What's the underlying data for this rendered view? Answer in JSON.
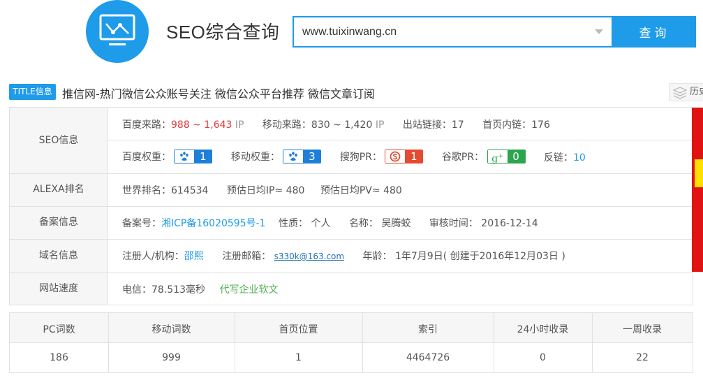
{
  "header": {
    "logo_icon": "line-chart-monitor-icon",
    "title": "SEO综合查询",
    "search_value": "www.tuixinwang.cn",
    "search_button": "查询",
    "accent_color": "#1e9be9"
  },
  "title_row": {
    "badge": "TITLE信息",
    "text": "推信网-热门微信公众账号关注 微信公众平台推荐 微信文章订阅",
    "history_label": "历史"
  },
  "seo": {
    "label": "SEO信息",
    "baidu_traffic_label": "百度来路：",
    "baidu_traffic_value": "988 ~ 1,643",
    "baidu_traffic_unit": "IP",
    "mobile_traffic_label": "移动来路：",
    "mobile_traffic_value": "830 ~ 1,420",
    "mobile_traffic_unit": "IP",
    "outbound_links_label": "出站链接：",
    "outbound_links_value": "17",
    "home_internal_links_label": "首页内链：",
    "home_internal_links_value": "176",
    "baidu_weight_label": "百度权重：",
    "baidu_weight_value": "1",
    "mobile_weight_label": "移动权重：",
    "mobile_weight_value": "3",
    "sogou_pr_label": "搜狗PR：",
    "sogou_pr_value": "1",
    "google_pr_label": "谷歌PR：",
    "google_pr_value": "0",
    "backlinks_label": "反链：",
    "backlinks_value": "10"
  },
  "alexa": {
    "label": "ALEXA排名",
    "world_rank_label": "世界排名：",
    "world_rank_value": "614534",
    "daily_ip_label": "预估日均IP≈",
    "daily_ip_value": "480",
    "daily_pv_label": "预估日均PV≈",
    "daily_pv_value": "480"
  },
  "icp": {
    "label": "备案信息",
    "number_label": "备案号：",
    "number_value": "湘ICP备16020595号-1",
    "nature_label": "性质：",
    "nature_value": "个人",
    "name_label": "名称：",
    "name_value": "吴腾蛟",
    "review_label": "审核时间：",
    "review_value": "2016-12-14"
  },
  "domain": {
    "label": "域名信息",
    "registrant_label": "注册人/机构：",
    "registrant_value": "邵熙",
    "email_label": "注册邮箱：",
    "email_value": "s330k@163.com",
    "age_label": "年龄：",
    "age_value": "1年7月9日",
    "created_note": "( 创建于2016年12月03日 )"
  },
  "speed": {
    "label": "网站速度",
    "telecom_label": "电信：",
    "telecom_value": "78.513毫秒",
    "ad_link": "代写企业软文"
  },
  "stats": {
    "headers": [
      "PC词数",
      "移动词数",
      "首页位置",
      "索引",
      "24小时收录",
      "一周收录"
    ],
    "values": [
      "186",
      "999",
      "1",
      "4464726",
      "0",
      "22"
    ]
  }
}
